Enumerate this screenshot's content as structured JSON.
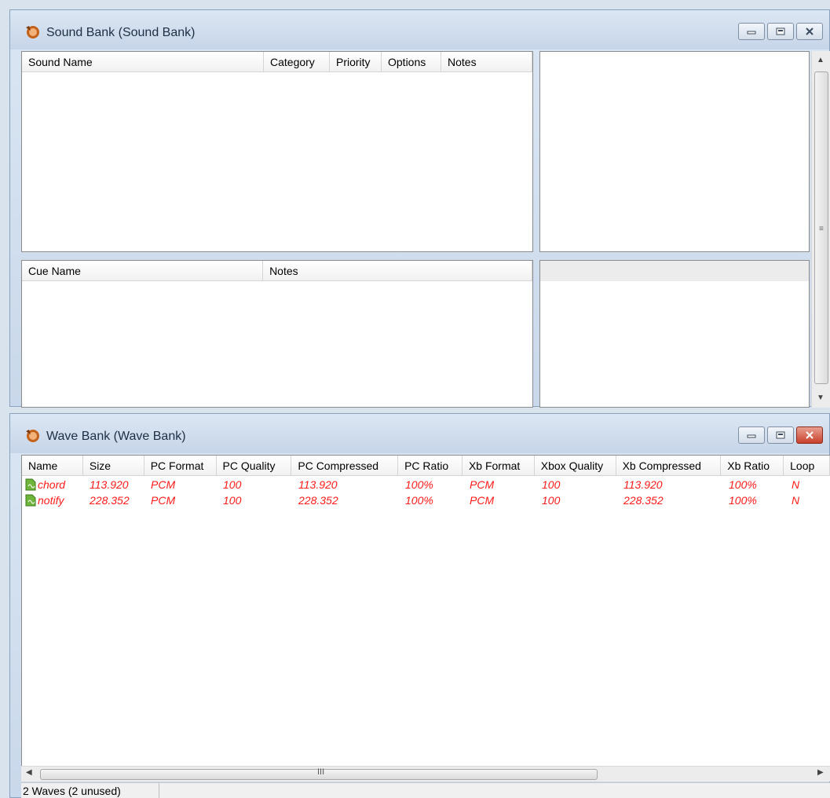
{
  "sound_bank_window": {
    "title": "Sound Bank (Sound Bank)",
    "sound_columns": [
      "Sound Name",
      "Category",
      "Priority",
      "Options",
      "Notes"
    ],
    "cue_columns": [
      "Cue Name",
      "Notes"
    ]
  },
  "wave_bank_window": {
    "title": "Wave Bank (Wave Bank)",
    "columns": [
      "Name",
      "Size",
      "PC Format",
      "PC Quality",
      "PC Compressed",
      "PC Ratio",
      "Xb Format",
      "Xbox Quality",
      "Xb Compressed",
      "Xb Ratio",
      "Loop"
    ],
    "rows": [
      {
        "name": "chord",
        "size": "113.920",
        "pc_format": "PCM",
        "pc_quality": "100",
        "pc_compressed": "113.920",
        "pc_ratio": "100%",
        "xb_format": "PCM",
        "xbox_quality": "100",
        "xb_compressed": "113.920",
        "xb_ratio": "100%",
        "loop": "N"
      },
      {
        "name": "notify",
        "size": "228.352",
        "pc_format": "PCM",
        "pc_quality": "100",
        "pc_compressed": "228.352",
        "pc_ratio": "100%",
        "xb_format": "PCM",
        "xbox_quality": "100",
        "xb_compressed": "228.352",
        "xb_ratio": "100%",
        "loop": "N"
      }
    ],
    "hscroll_grip": "III",
    "status": "2 Waves (2 unused)"
  },
  "icons": {
    "app": "xact-app-icon",
    "wave": "wave-file-icon",
    "minimize": "minimize-icon",
    "restore": "restore-icon",
    "close": "close-icon"
  },
  "colors": {
    "unused_wave_text": "#ff1a1a",
    "close_active": "#c8402c"
  }
}
